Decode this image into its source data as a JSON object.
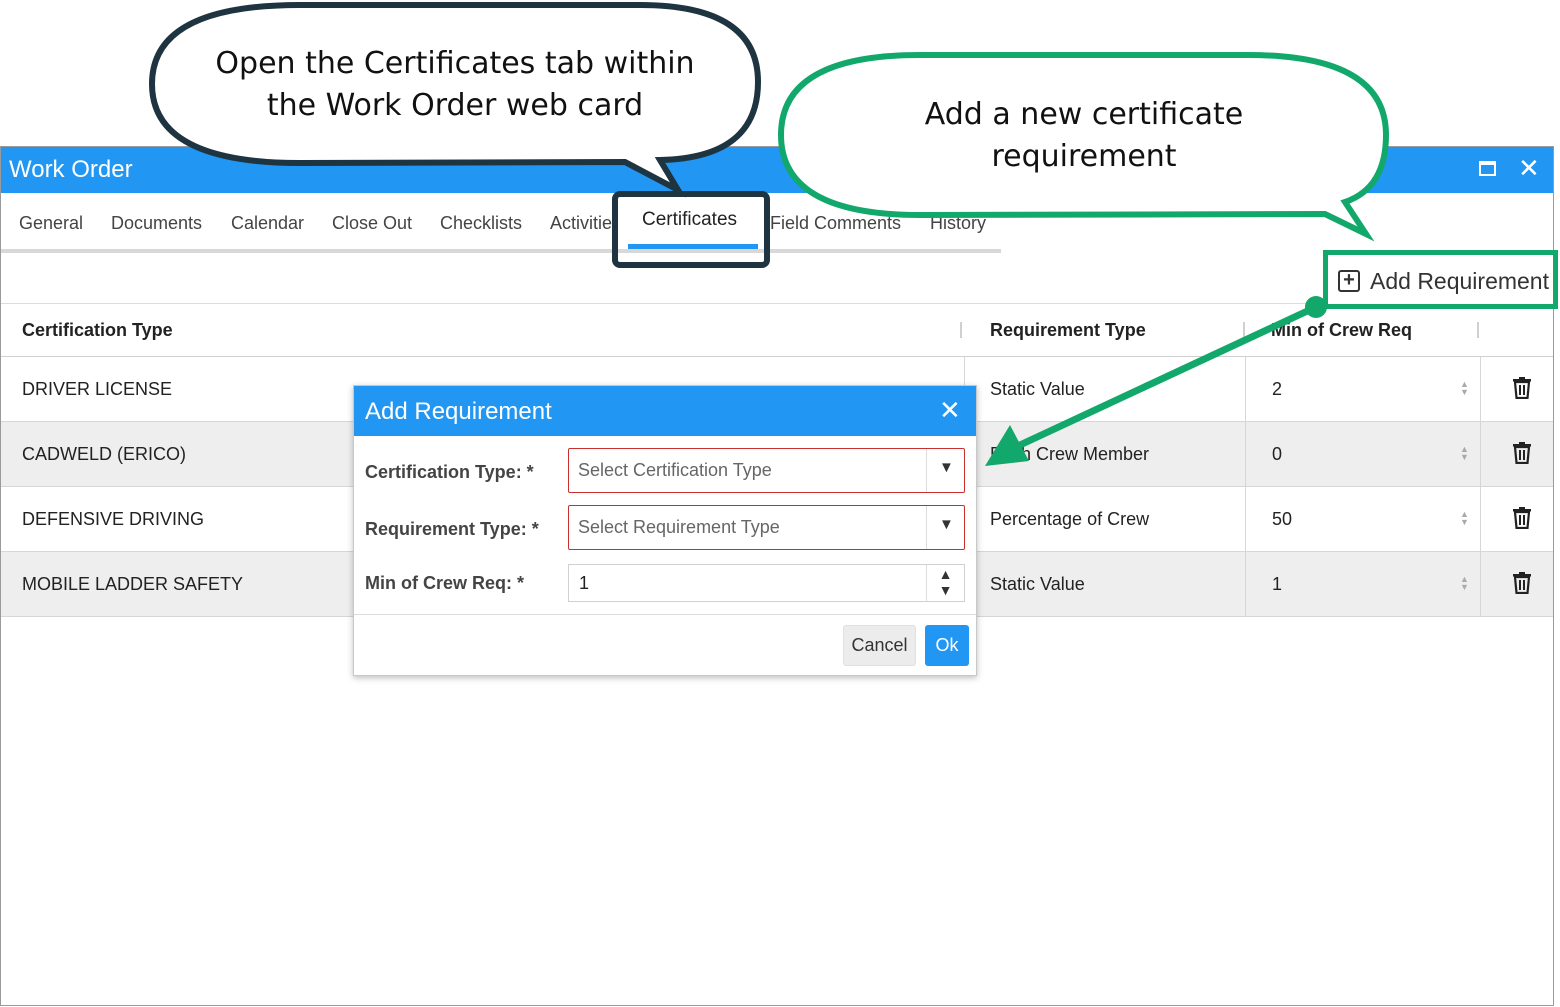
{
  "window": {
    "title": "Work Order",
    "tabs": [
      "General",
      "Documents",
      "Calendar",
      "Close Out",
      "Checklists",
      "Activitie",
      "Certificates",
      "Field Comments",
      "History"
    ],
    "active_tab": "Certificates"
  },
  "toolbar": {
    "add_requirement_label": "Add Requirement"
  },
  "grid": {
    "columns": [
      "Certification Type",
      "Requirement Type",
      "Min of Crew Req"
    ],
    "rows": [
      {
        "certification_type": "DRIVER LICENSE",
        "requirement_type": "Static Value",
        "min_crew": "2"
      },
      {
        "certification_type": "CADWELD (ERICO)",
        "requirement_type": "Each Crew Member",
        "min_crew": "0"
      },
      {
        "certification_type": "DEFENSIVE DRIVING",
        "requirement_type": "Percentage of Crew",
        "min_crew": "50"
      },
      {
        "certification_type": "MOBILE LADDER SAFETY",
        "requirement_type": "Static Value",
        "min_crew": "1"
      }
    ]
  },
  "dialog": {
    "title": "Add Requirement",
    "certification_type_label": "Certification Type: *",
    "certification_type_placeholder": "Select Certification Type",
    "requirement_type_label": "Requirement Type: *",
    "requirement_type_placeholder": "Select Requirement Type",
    "min_crew_label": "Min of Crew Req: *",
    "min_crew_value": "1",
    "cancel_label": "Cancel",
    "ok_label": "Ok"
  },
  "callouts": {
    "tab_callout": [
      "Open the Certificates tab within",
      "the Work Order web card"
    ],
    "add_callout": [
      "Add a new certificate",
      "requirement"
    ]
  },
  "colors": {
    "titlebar": "#2196f3",
    "callout_dark": "#1e3440",
    "callout_green": "#13a86b",
    "required_border": "#c9302c"
  }
}
